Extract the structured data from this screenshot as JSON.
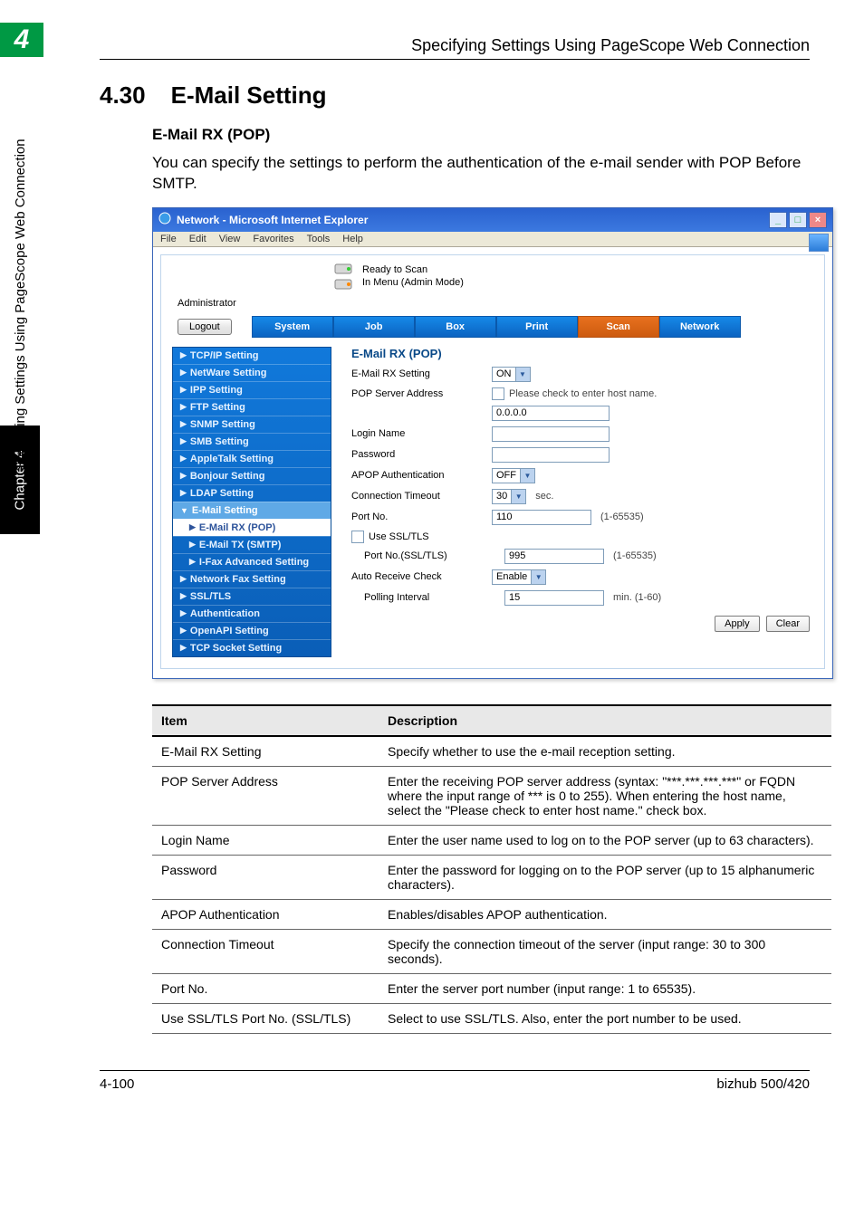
{
  "chapter_badge": "4",
  "header_line": "Specifying Settings Using PageScope Web Connection",
  "section_num": "4.30",
  "section_title": "E-Mail Setting",
  "subsection": "E-Mail RX (POP)",
  "body_text": "You can specify the settings to perform the authentication of the e-mail sender with POP Before SMTP.",
  "browser": {
    "title": "Network - Microsoft Internet Explorer",
    "menus": [
      "File",
      "Edit",
      "View",
      "Favorites",
      "Tools",
      "Help"
    ],
    "status1": "Ready to Scan",
    "status2": "In Menu (Admin Mode)",
    "admin": "Administrator",
    "logout": "Logout",
    "tabs": [
      "System",
      "Job",
      "Box",
      "Print",
      "Scan",
      "Network"
    ],
    "sidebar": [
      "TCP/IP Setting",
      "NetWare Setting",
      "IPP Setting",
      "FTP Setting",
      "SNMP Setting",
      "SMB Setting",
      "AppleTalk Setting",
      "Bonjour Setting",
      "LDAP Setting"
    ],
    "sidebar_sel_head": "E-Mail Setting",
    "sidebar_sub": [
      "E-Mail RX (POP)",
      "E-Mail TX (SMTP)",
      "I-Fax Advanced Setting"
    ],
    "sidebar_rest": [
      "Network Fax Setting",
      "SSL/TLS",
      "Authentication",
      "OpenAPI Setting",
      "TCP Socket Setting"
    ],
    "detail_title": "E-Mail RX (POP)",
    "form": {
      "rx_label": "E-Mail RX Setting",
      "rx_value": "ON",
      "pop_label": "POP Server Address",
      "pop_check": "Please check to enter host name.",
      "pop_value": "0.0.0.0",
      "login_label": "Login Name",
      "login_value": "",
      "pass_label": "Password",
      "pass_value": "",
      "apop_label": "APOP Authentication",
      "apop_value": "OFF",
      "conn_label": "Connection Timeout",
      "conn_value": "30",
      "conn_unit": "sec.",
      "port_label": "Port No.",
      "port_value": "110",
      "port_range": "(1-65535)",
      "ssl_label": "Use SSL/TLS",
      "sslport_label": "Port No.(SSL/TLS)",
      "sslport_value": "995",
      "sslport_range": "(1-65535)",
      "auto_label": "Auto Receive Check",
      "auto_value": "Enable",
      "poll_label": "Polling Interval",
      "poll_value": "15",
      "poll_unit": "min. (1-60)"
    },
    "apply": "Apply",
    "clear": "Clear"
  },
  "table": {
    "h1": "Item",
    "h2": "Description",
    "rows": [
      [
        "E-Mail RX Setting",
        "Specify whether to use the e-mail reception setting."
      ],
      [
        "POP Server Address",
        "Enter the receiving POP server address (syntax: \"***.***.***.***\" or FQDN where the input range of *** is 0 to 255). When entering the host name, select the \"Please check to enter host name.\" check box."
      ],
      [
        "Login Name",
        "Enter the user name used to log on to the POP server (up to 63 characters)."
      ],
      [
        "Password",
        "Enter the password for logging on to the POP server (up to 15 alphanumeric characters)."
      ],
      [
        "APOP Authentication",
        "Enables/disables APOP authentication."
      ],
      [
        "Connection Timeout",
        "Specify the connection timeout of the server (input range: 30 to 300 seconds)."
      ],
      [
        "Port No.",
        "Enter the server port number (input range: 1 to 65535)."
      ],
      [
        "Use SSL/TLS Port No. (SSL/TLS)",
        "Select to use SSL/TLS. Also, enter the port number to be used."
      ]
    ]
  },
  "side_text": "Specifying Settings Using PageScope Web Connection",
  "chapter_tab": "Chapter 4",
  "footer_left": "4-100",
  "footer_right": "bizhub 500/420"
}
